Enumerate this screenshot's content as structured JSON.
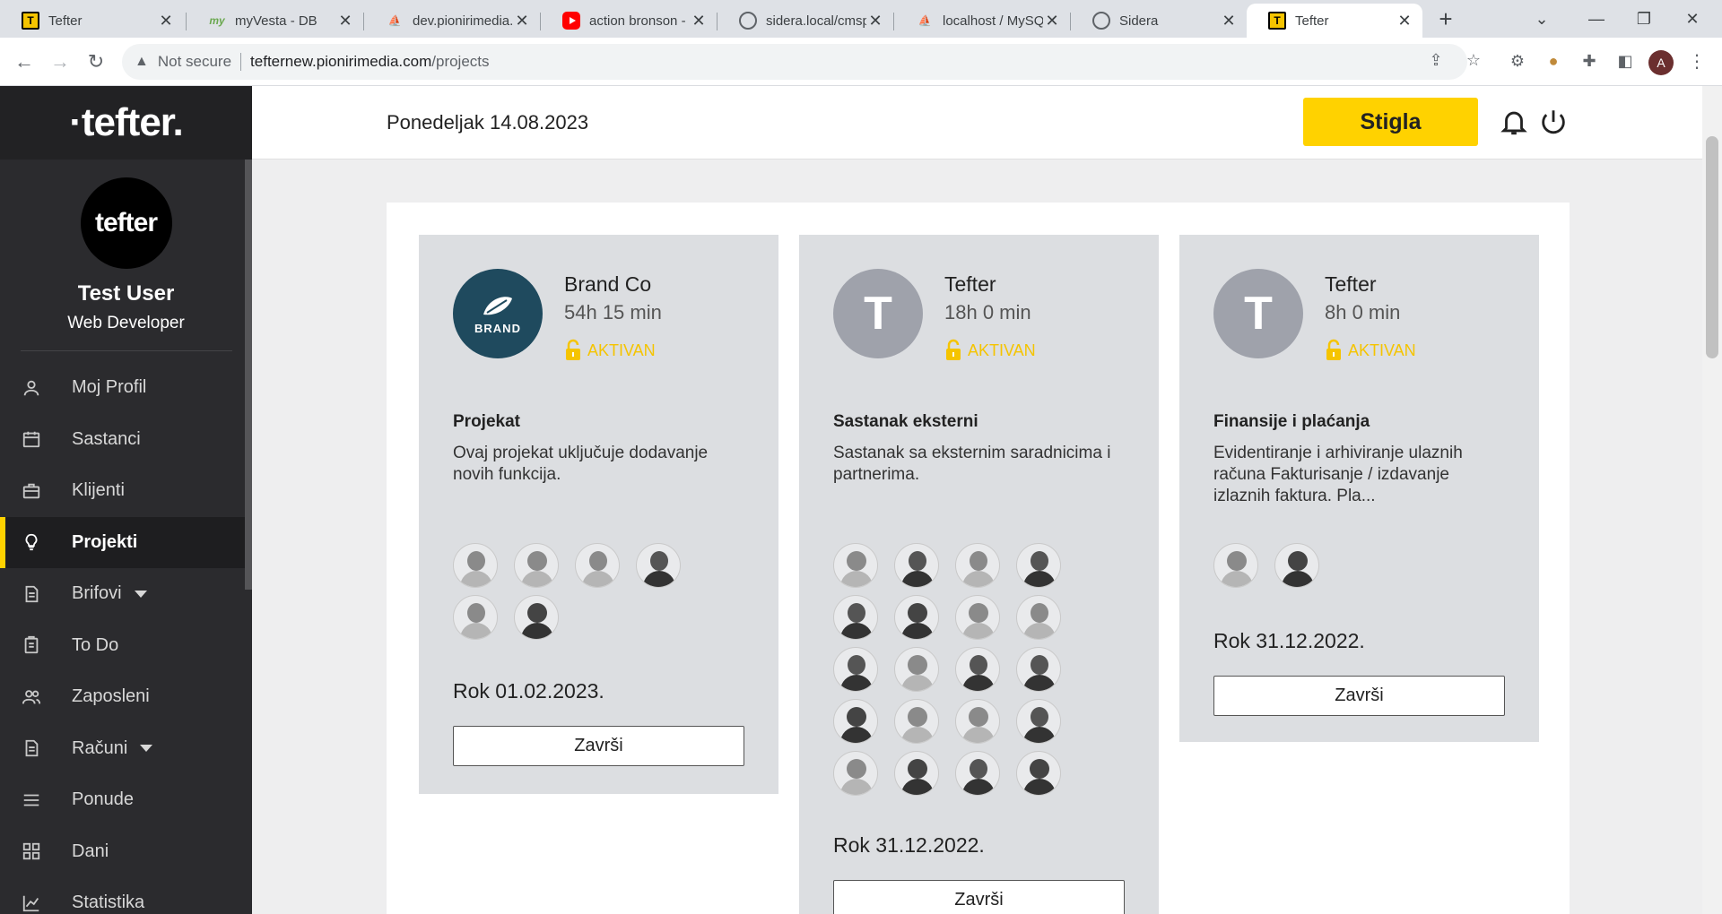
{
  "browser": {
    "tabs": [
      {
        "title": "Tefter",
        "favicon": "tefter-favicon",
        "active": false
      },
      {
        "title": "myVesta - DB",
        "favicon": "myvesta-favicon",
        "active": false
      },
      {
        "title": "dev.pionirimedia.",
        "favicon": "phpmyadmin-favicon",
        "active": false
      },
      {
        "title": "action bronson -",
        "favicon": "youtube-favicon",
        "active": false
      },
      {
        "title": "sidera.local/cmsp",
        "favicon": "globe-favicon",
        "active": false
      },
      {
        "title": "localhost / MySQ",
        "favicon": "phpmyadmin-favicon",
        "active": false
      },
      {
        "title": "Sidera",
        "favicon": "globe-favicon",
        "active": false
      },
      {
        "title": "Tefter",
        "favicon": "tefter-favicon",
        "active": true
      }
    ],
    "security_label": "Not secure",
    "url_host": "tefternew.pionirimedia.com",
    "url_path": "/projects",
    "profile_initial": "A"
  },
  "sidebar": {
    "logo": "·tefter.",
    "avatar_text": "tefter",
    "user_name": "Test User",
    "user_role": "Web Developer",
    "items": [
      {
        "label": "Moj Profil",
        "icon": "user-icon"
      },
      {
        "label": "Sastanci",
        "icon": "calendar-icon"
      },
      {
        "label": "Klijenti",
        "icon": "briefcase-icon"
      },
      {
        "label": "Projekti",
        "icon": "lightbulb-icon",
        "active": true
      },
      {
        "label": "Brifovi",
        "icon": "document-icon",
        "dropdown": true
      },
      {
        "label": "To Do",
        "icon": "clipboard-icon"
      },
      {
        "label": "Zaposleni",
        "icon": "users-icon"
      },
      {
        "label": "Računi",
        "icon": "document-icon",
        "dropdown": true
      },
      {
        "label": "Ponude",
        "icon": "list-icon"
      },
      {
        "label": "Dani",
        "icon": "grid-icon"
      },
      {
        "label": "Statistika",
        "icon": "chart-icon"
      }
    ]
  },
  "header": {
    "date": "Ponedeljak 14.08.2023",
    "inbox_button": "Stigla"
  },
  "colors": {
    "accent": "#ffd200",
    "sidebar_bg": "#2b2b2e",
    "card_bg": "#dcdee1",
    "brand_logo": "#1f4a5e",
    "status_active": "#f5c400"
  },
  "projects": [
    {
      "client": "Brand Co",
      "time": "54h 15 min",
      "status": "AKTIVAN",
      "logo_text": "BRAND",
      "title": "Projekat",
      "description": "Ovaj projekat uključuje dodavanje novih funkcija.",
      "member_count": 6,
      "deadline": "Rok 01.02.2023.",
      "button": "Završi"
    },
    {
      "client": "Tefter",
      "time": "18h 0 min",
      "status": "AKTIVAN",
      "logo_text": "T",
      "title": "Sastanak eksterni",
      "description": "Sastanak sa eksternim saradnicima i partnerima.",
      "member_count": 20,
      "deadline": "Rok 31.12.2022.",
      "button": "Završi"
    },
    {
      "client": "Tefter",
      "time": "8h 0 min",
      "status": "AKTIVAN",
      "logo_text": "T",
      "title": "Finansije i plaćanja",
      "description": "Evidentiranje i arhiviranje ulaznih računa Fakturisanje / izdavanje izlaznih faktura. Pla...",
      "member_count": 2,
      "deadline": "Rok 31.12.2022.",
      "button": "Završi"
    }
  ]
}
